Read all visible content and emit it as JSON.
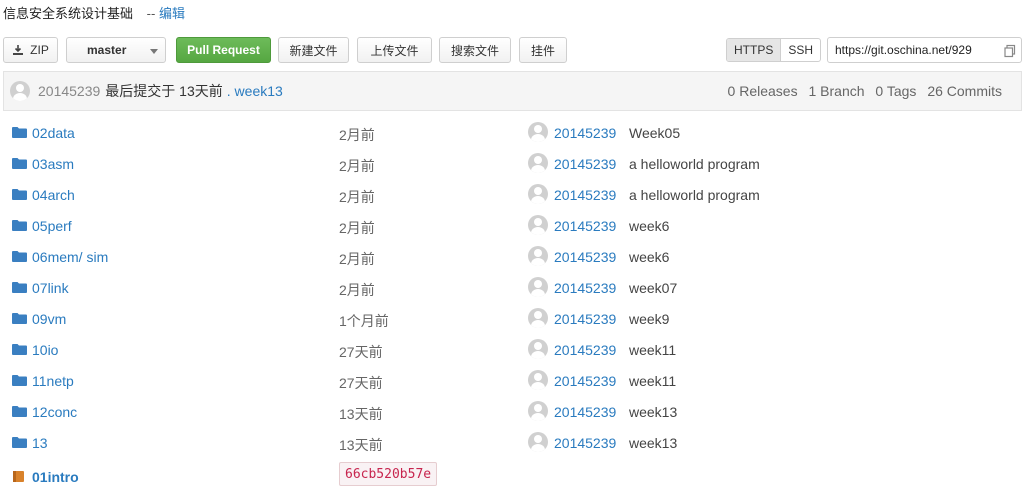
{
  "repo": {
    "title": "信息安全系统设计基础",
    "edit_sep": "--",
    "edit_label": "编辑"
  },
  "toolbar": {
    "zip_label": "ZIP",
    "branch_label": "master",
    "pull_request_label": "Pull Request",
    "new_file_label": "新建文件",
    "upload_file_label": "上传文件",
    "search_file_label": "搜索文件",
    "plugin_label": "挂件",
    "https_label": "HTTPS",
    "ssh_label": "SSH",
    "clone_url": "https://git.oschina.net/929"
  },
  "last_commit": {
    "author": "20145239",
    "text": "最后提交于 13天前",
    "message": ". week13",
    "releases": "0 Releases",
    "branches": "1 Branch",
    "tags": "0 Tags",
    "commits": "26 Commits"
  },
  "files": [
    {
      "name": "02data",
      "time": "2月前",
      "author": "20145239",
      "message": "Week05"
    },
    {
      "name": "03asm",
      "time": "2月前",
      "author": "20145239",
      "message": "a helloworld program"
    },
    {
      "name": "04arch",
      "time": "2月前",
      "author": "20145239",
      "message": "a helloworld program"
    },
    {
      "name": "05perf",
      "time": "2月前",
      "author": "20145239",
      "message": "week6"
    },
    {
      "name": "06mem/",
      "sub": "sim",
      "time": "2月前",
      "author": "20145239",
      "message": "week6"
    },
    {
      "name": "07link",
      "time": "2月前",
      "author": "20145239",
      "message": "week07"
    },
    {
      "name": "09vm",
      "time": "1个月前",
      "author": "20145239",
      "message": "week9"
    },
    {
      "name": "10io",
      "time": "27天前",
      "author": "20145239",
      "message": "week11"
    },
    {
      "name": "11netp",
      "time": "27天前",
      "author": "20145239",
      "message": "week11"
    },
    {
      "name": "12conc",
      "time": "13天前",
      "author": "20145239",
      "message": "week13"
    },
    {
      "name": "13",
      "time": "13天前",
      "author": "20145239",
      "message": "week13"
    }
  ],
  "submodule": {
    "name": "01intro",
    "hash": "66cb520b57e"
  },
  "colors": {
    "link": "#2a7bbf",
    "folder": "#3a7fc1",
    "pull_request": "#5cb047",
    "hash": "#c7254e"
  }
}
